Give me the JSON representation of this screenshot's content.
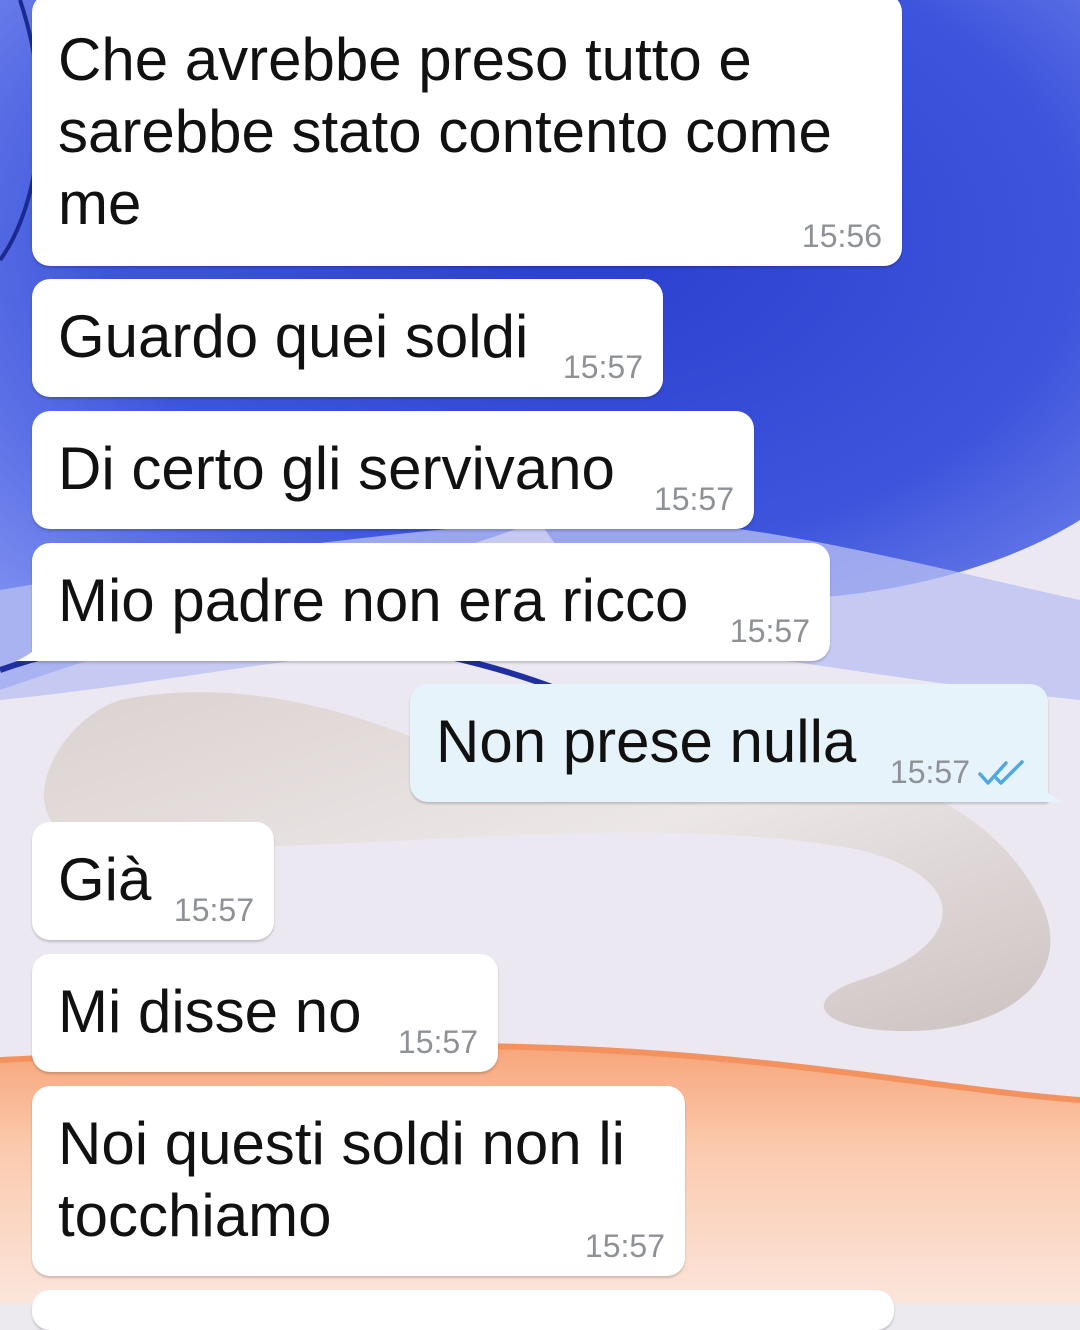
{
  "messages": [
    {
      "direction": "in",
      "text": "Che avrebbe preso tutto e sarebbe stato contento come me",
      "time": "15:56"
    },
    {
      "direction": "in",
      "text": "Guardo quei soldi",
      "time": "15:57"
    },
    {
      "direction": "in",
      "text": "Di certo gli servivano",
      "time": "15:57"
    },
    {
      "direction": "in",
      "text": "Mio padre non era ricco",
      "time": "15:57"
    },
    {
      "direction": "out",
      "text": "Non prese nulla",
      "time": "15:57",
      "status": "read"
    },
    {
      "direction": "in",
      "text": "Già",
      "time": "15:57"
    },
    {
      "direction": "in",
      "text": "Mi disse no",
      "time": "15:57"
    },
    {
      "direction": "in",
      "text": "Noi questi soldi non li tocchiamo",
      "time": "15:57"
    }
  ],
  "colors": {
    "incoming_bubble": "#ffffff",
    "outgoing_bubble": "#e7f3fa",
    "timestamp": "#8e9196",
    "read_ticks": "#4fa8e0",
    "wallpaper_blue": "#3f55d8",
    "wallpaper_beige": "#e3d8d2",
    "wallpaper_orange": "#f6a377"
  },
  "icons": {
    "read_status": "double-check-icon"
  }
}
